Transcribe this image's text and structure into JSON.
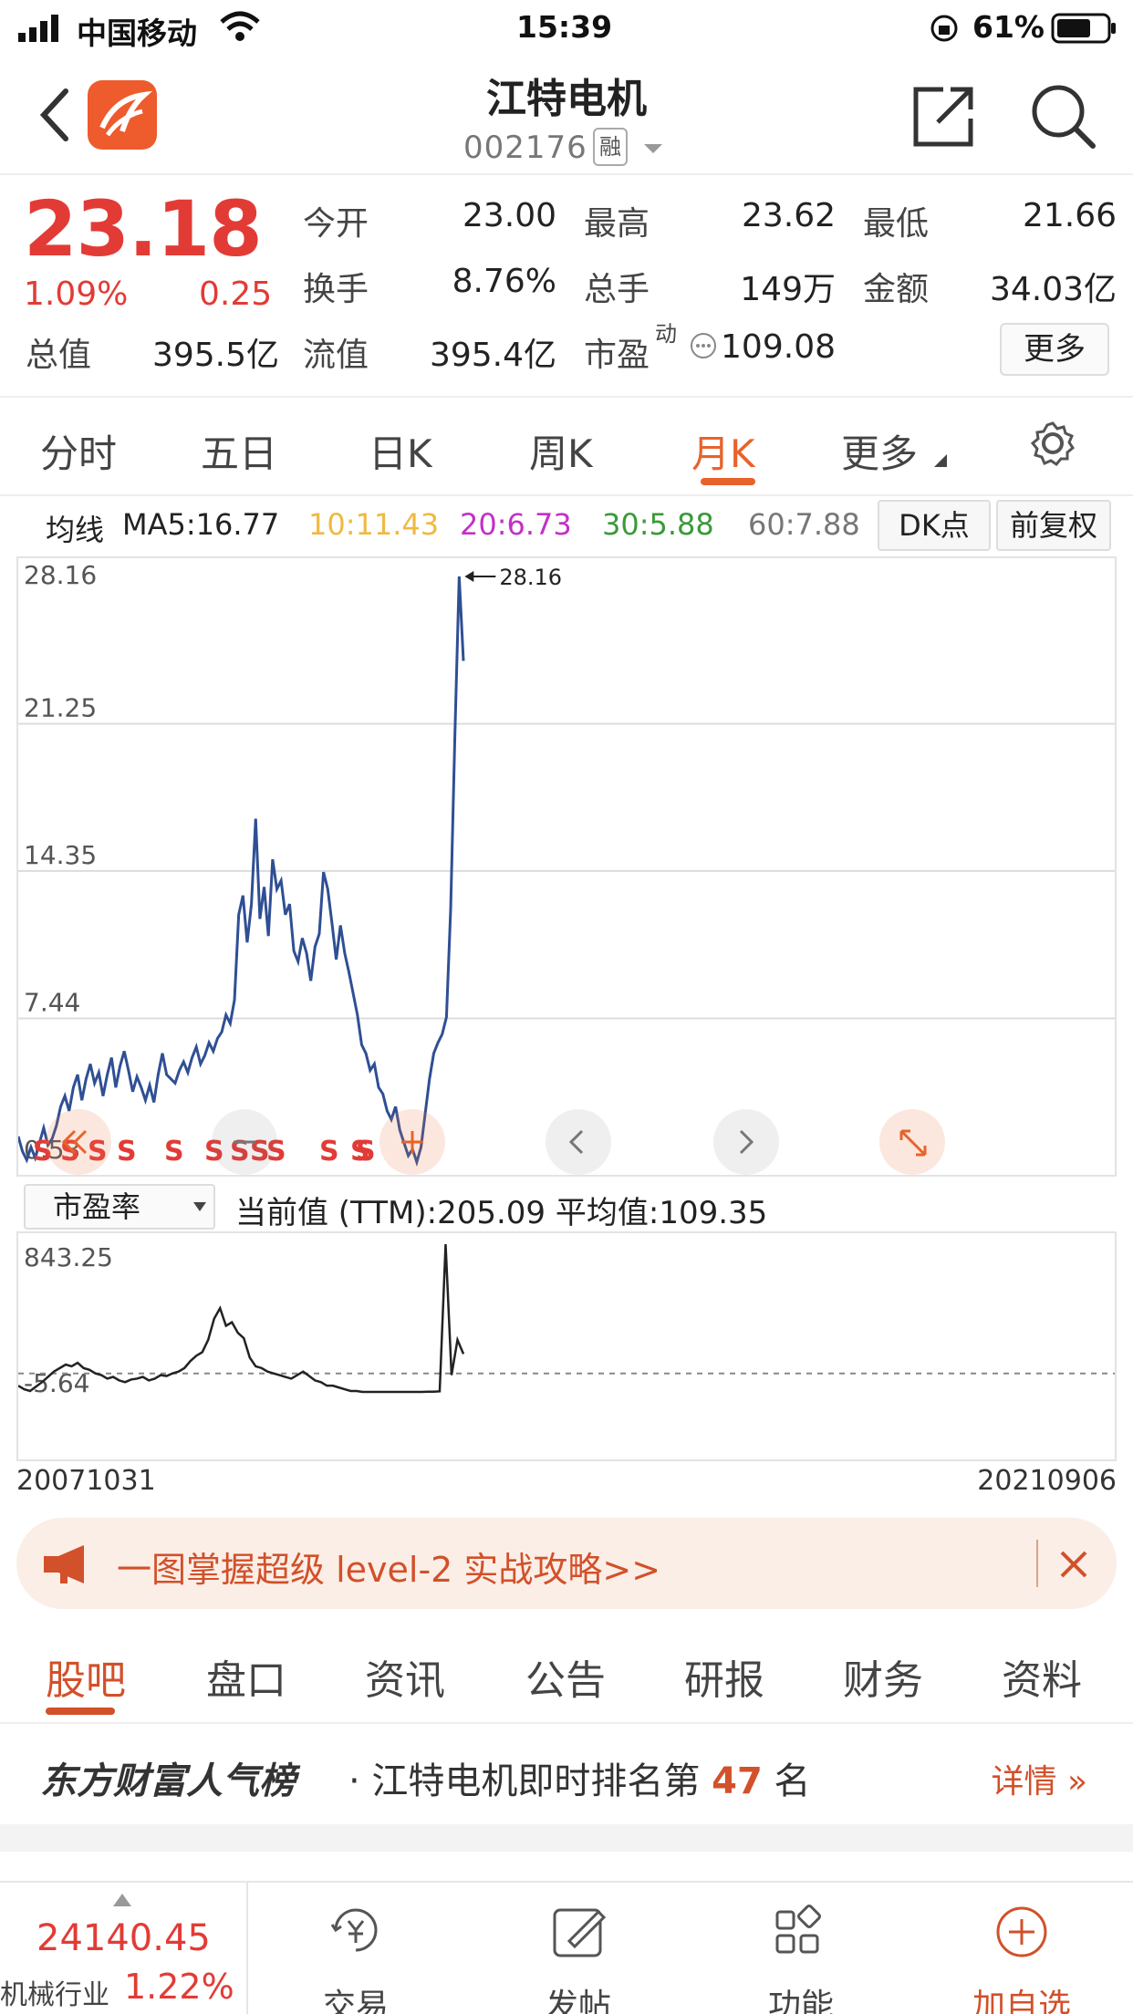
{
  "status_bar": {
    "carrier": "中国移动",
    "time": "15:39",
    "battery": "61%"
  },
  "header": {
    "title": "江特电机",
    "code": "002176",
    "badge": "融"
  },
  "quote": {
    "price": "23.18",
    "change_pct": "1.09%",
    "change_amt": "0.25",
    "fields": {
      "open_label": "今开",
      "open_value": "23.00",
      "high_label": "最高",
      "high_value": "23.62",
      "low_label": "最低",
      "low_value": "21.66",
      "turnover_label": "换手",
      "turnover_value": "8.76%",
      "volume_label": "总手",
      "volume_value": "149万",
      "amount_label": "金额",
      "amount_value": "34.03亿",
      "mktcap_label": "总值",
      "mktcap_value": "395.5亿",
      "float_label": "流值",
      "float_value": "395.4亿",
      "pe_label": "市盈",
      "pe_sup": "动",
      "pe_value": "109.08"
    },
    "more_button": "更多"
  },
  "period_tabs": {
    "items": [
      "分时",
      "五日",
      "日K",
      "周K",
      "月K",
      "更多"
    ],
    "active": "月K"
  },
  "ma_row": {
    "label": "均线",
    "ma5": "MA5:16.77",
    "ma10": "10:11.43",
    "ma20": "20:6.73",
    "ma30": "30:5.88",
    "ma60": "60:7.88",
    "dk_button": "DK点",
    "fq_button": "前复权",
    "colors": {
      "ma5": "#222222",
      "ma10": "#f0b940",
      "ma20": "#c231c8",
      "ma30": "#3a9a3a",
      "ma60": "#777777"
    }
  },
  "chart_data": [
    {
      "type": "line",
      "title": "",
      "y_ticks": [
        "28.16",
        "21.25",
        "14.35",
        "7.44",
        "0.53"
      ],
      "ylim": [
        0.53,
        28.16
      ],
      "max_label": "28.16",
      "series": [
        {
          "values": [
            1.9,
            1.2,
            0.8,
            1.4,
            0.9,
            1.6,
            2.3,
            1.5,
            1.8,
            2.4,
            3.3,
            3.8,
            3.1,
            4.2,
            4.8,
            3.6,
            4.6,
            5.3,
            4.4,
            4.9,
            3.8,
            4.8,
            5.6,
            4.2,
            5.2,
            5.9,
            5.0,
            4.0,
            4.7,
            4.2,
            3.6,
            4.3,
            3.5,
            4.8,
            5.8,
            4.8,
            4.6,
            4.4,
            5.0,
            5.4,
            4.9,
            5.6,
            6.1,
            5.3,
            5.7,
            6.3,
            5.9,
            6.5,
            6.8,
            7.6,
            7.2,
            8.3,
            12.3,
            13.2,
            11.0,
            12.8,
            16.8,
            12.1,
            13.6,
            11.3,
            14.9,
            13.5,
            13.9,
            12.3,
            12.8,
            10.6,
            10.1,
            11.2,
            10.5,
            9.2,
            10.8,
            11.4,
            14.3,
            13.5,
            11.9,
            10.2,
            11.8,
            10.5,
            9.6,
            8.6,
            7.6,
            6.2,
            5.8,
            5.0,
            5.3,
            4.2,
            3.9,
            3.1,
            2.7,
            3.3,
            2.2,
            1.6,
            1.0,
            1.3,
            0.7,
            1.4,
            3.0,
            4.6,
            5.8,
            6.3,
            6.7,
            7.5,
            12.6,
            20.8,
            28.16,
            24.2
          ]
        }
      ],
      "markers": [
        "S",
        "S",
        "S",
        "S",
        "S",
        "S",
        "S",
        "S",
        "S",
        "S",
        "S",
        "S"
      ]
    },
    {
      "type": "line",
      "title": "",
      "y_ticks": [
        "843.25",
        "-5.64"
      ],
      "ylim": [
        -5.64,
        843.25
      ],
      "series": [
        {
          "values": [
            40,
            20,
            10,
            35,
            60,
            90,
            120,
            140,
            160,
            150,
            170,
            140,
            130,
            110,
            100,
            80,
            90,
            70,
            60,
            75,
            80,
            90,
            70,
            80,
            100,
            95,
            110,
            120,
            140,
            180,
            210,
            230,
            300,
            420,
            480,
            380,
            400,
            340,
            310,
            200,
            150,
            140,
            120,
            110,
            100,
            90,
            80,
            100,
            120,
            95,
            70,
            60,
            40,
            40,
            30,
            20,
            10,
            10,
            5,
            5,
            5,
            5,
            5,
            5,
            5,
            5,
            5,
            5,
            5,
            6,
            6,
            8,
            843.25,
            100,
            300,
            220
          ]
        }
      ],
      "average_line_value": 109.35
    }
  ],
  "pe_row": {
    "select_label": "市盈率",
    "current_label": "当前值 (TTM):205.09",
    "average_label": "平均值:109.35"
  },
  "dates": {
    "start": "20071031",
    "end": "20210906"
  },
  "banner": {
    "text": "一图掌握超级 level-2 实战攻略>>"
  },
  "section_tabs": {
    "items": [
      "股吧",
      "盘口",
      "资讯",
      "公告",
      "研报",
      "财务",
      "资料"
    ],
    "active": "股吧"
  },
  "rank": {
    "brand": "东方财富人气榜",
    "text_prefix": "· 江特电机即时排名第",
    "number": "47",
    "suffix": "名",
    "detail": "详情"
  },
  "bottom_bar": {
    "index_value": "24140.45",
    "index_name": "机械行业",
    "index_pct": "1.22%",
    "items": [
      {
        "label": "交易",
        "icon": "yuan-cycle-icon"
      },
      {
        "label": "发帖",
        "icon": "edit-icon"
      },
      {
        "label": "功能",
        "icon": "apps-grid-icon"
      },
      {
        "label": "加自选",
        "icon": "plus-circle-icon"
      }
    ]
  }
}
